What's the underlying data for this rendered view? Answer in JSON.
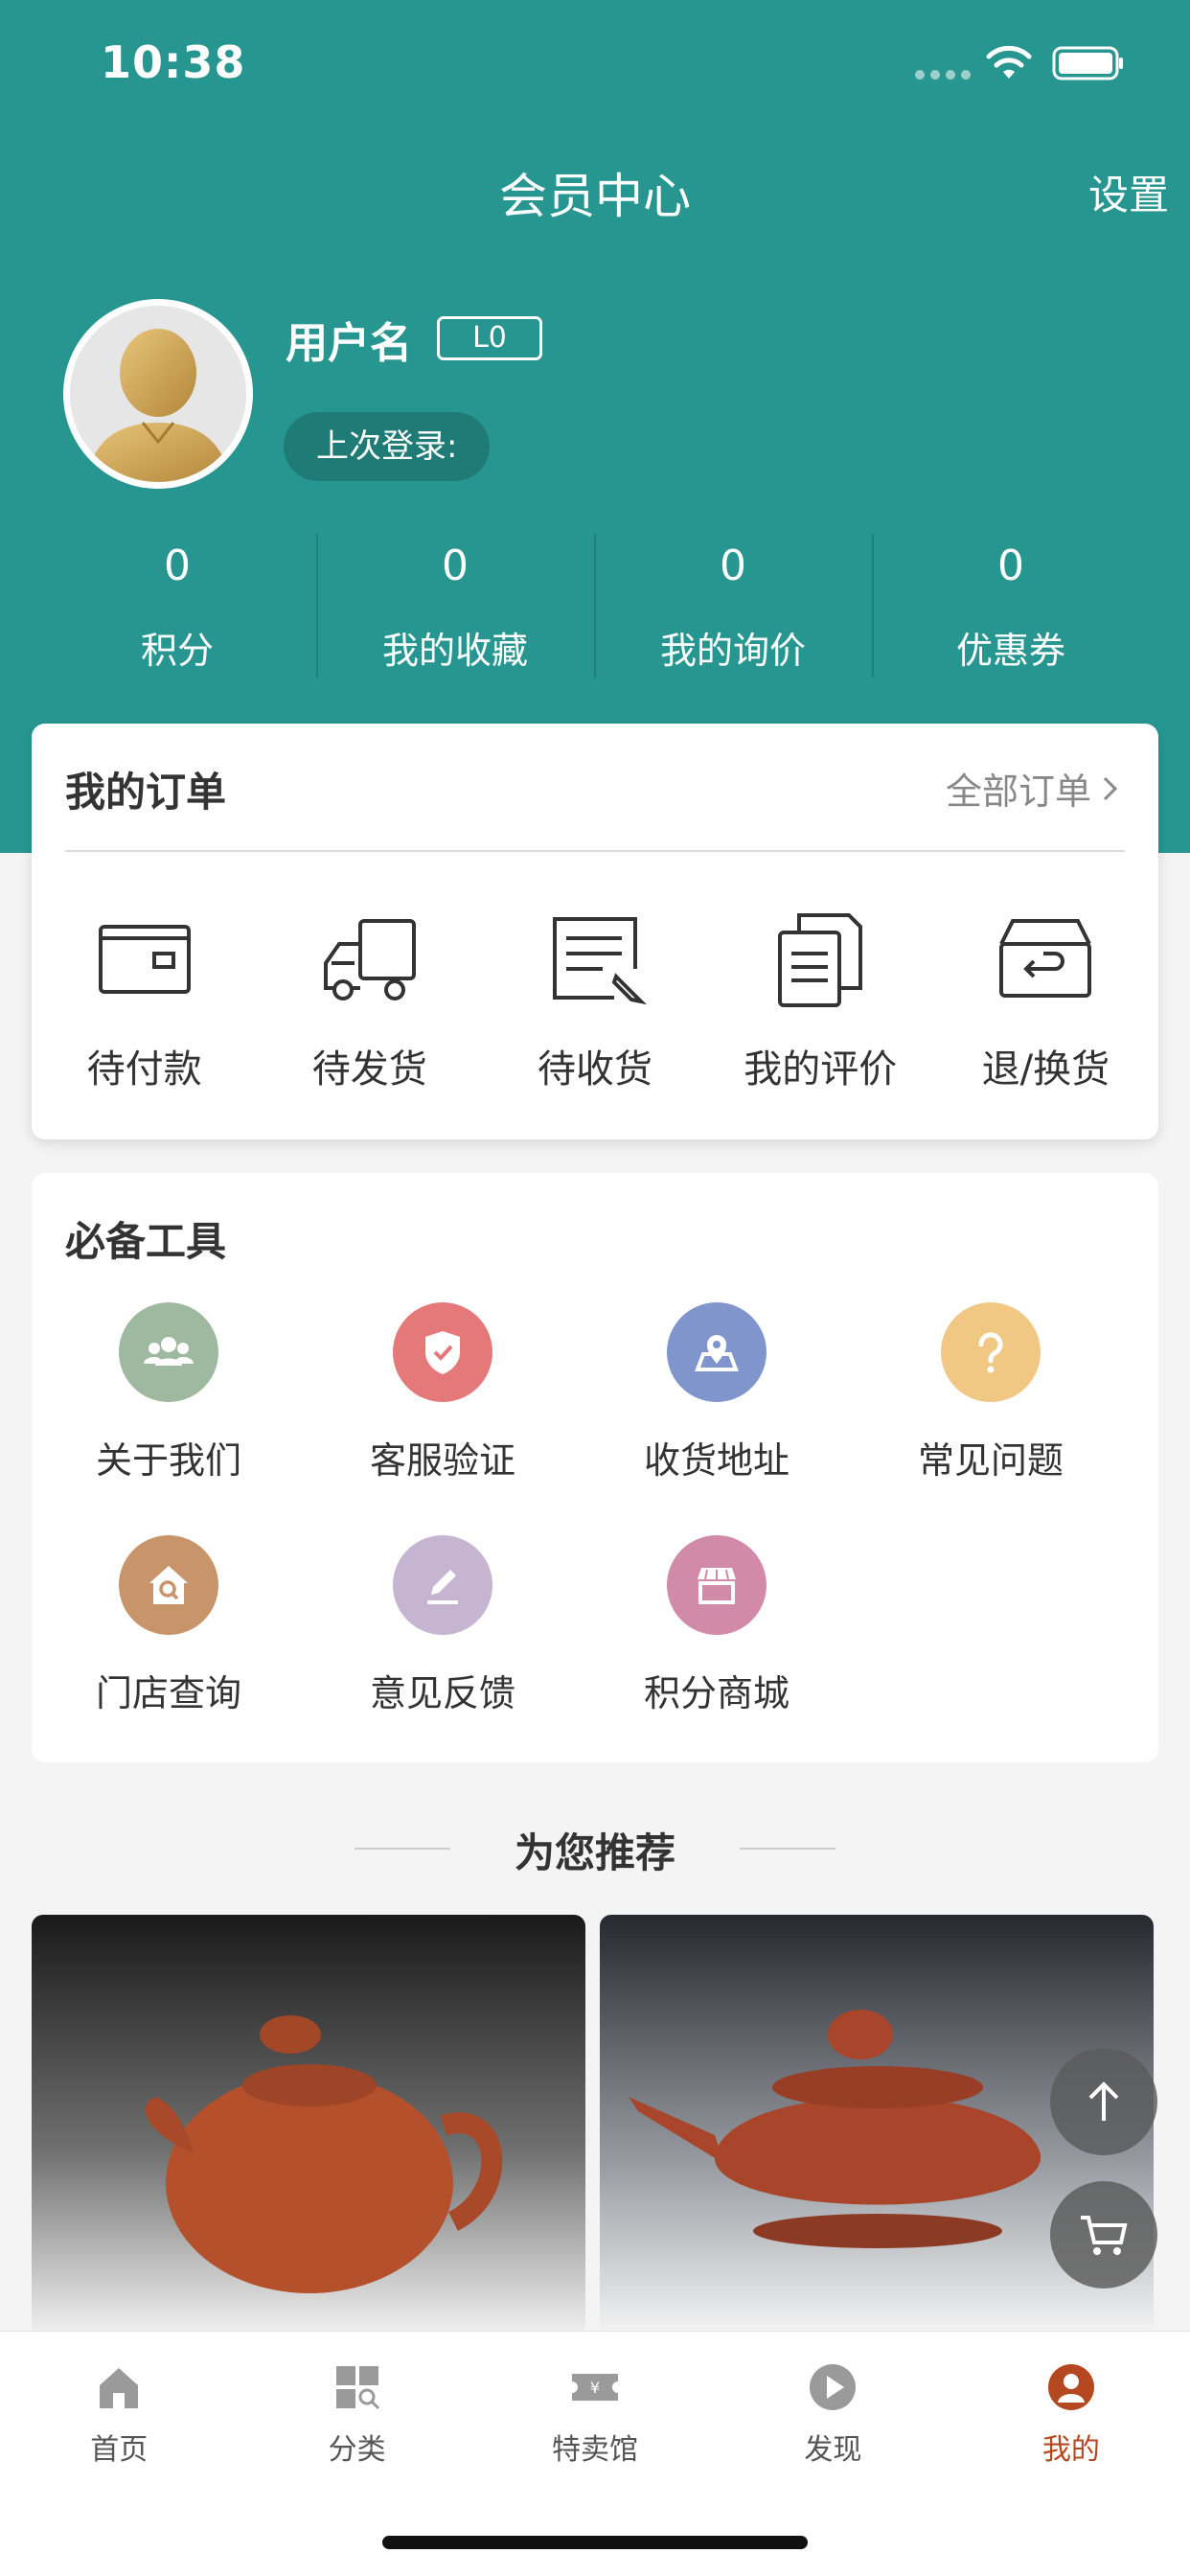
{
  "status_bar": {
    "time": "10:38"
  },
  "nav": {
    "title": "会员中心",
    "settings": "设置"
  },
  "profile": {
    "username": "用户名",
    "level": "L0",
    "last_login": "上次登录:"
  },
  "stats": [
    {
      "value": "0",
      "label": "积分"
    },
    {
      "value": "0",
      "label": "我的收藏"
    },
    {
      "value": "0",
      "label": "我的询价"
    },
    {
      "value": "0",
      "label": "优惠券"
    }
  ],
  "orders": {
    "title": "我的订单",
    "all_orders": "全部订单",
    "items": [
      {
        "label": "待付款",
        "icon": "wallet-icon"
      },
      {
        "label": "待发货",
        "icon": "truck-icon"
      },
      {
        "label": "待收货",
        "icon": "receipt-icon"
      },
      {
        "label": "我的评价",
        "icon": "documents-icon"
      },
      {
        "label": "退/换货",
        "icon": "return-box-icon"
      }
    ]
  },
  "tools": {
    "title": "必备工具",
    "items": [
      {
        "label": "关于我们",
        "icon": "group-icon",
        "color": "#9fb8a0"
      },
      {
        "label": "客服验证",
        "icon": "shield-check-icon",
        "color": "#e57878"
      },
      {
        "label": "收货地址",
        "icon": "location-icon",
        "color": "#7f95cc"
      },
      {
        "label": "常见问题",
        "icon": "question-icon",
        "color": "#f0c884"
      },
      {
        "label": "门店查询",
        "icon": "store-search-icon",
        "color": "#c8956a"
      },
      {
        "label": "意见反馈",
        "icon": "edit-icon",
        "color": "#c5b5d0"
      },
      {
        "label": "积分商城",
        "icon": "shop-icon",
        "color": "#d18aa7"
      }
    ]
  },
  "recommend": {
    "title": "为您推荐"
  },
  "tabbar": {
    "items": [
      {
        "label": "首页",
        "icon": "home-icon"
      },
      {
        "label": "分类",
        "icon": "category-icon"
      },
      {
        "label": "特卖馆",
        "icon": "ticket-icon"
      },
      {
        "label": "发现",
        "icon": "play-icon"
      },
      {
        "label": "我的",
        "icon": "user-icon",
        "active": true
      }
    ]
  },
  "colors": {
    "primary": "#279691",
    "active_tab": "#b44821"
  }
}
